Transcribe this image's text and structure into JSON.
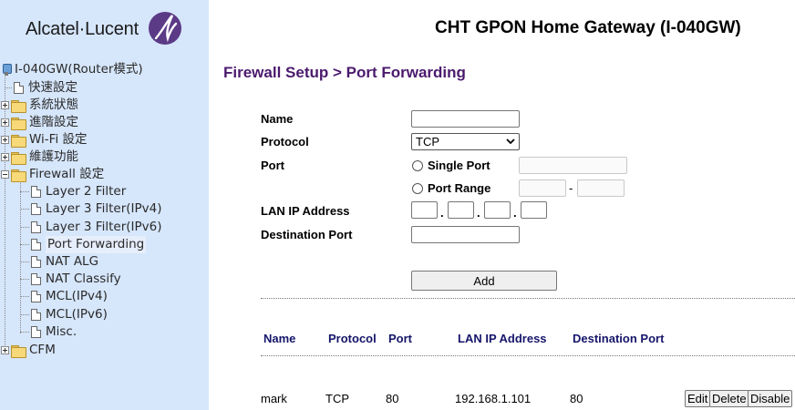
{
  "brand": {
    "logo_text": "Alcatel·Lucent"
  },
  "header": {
    "gateway_title": "CHT GPON Home Gateway (I-040GW)"
  },
  "sidebar": {
    "root_label": "I-040GW(Router模式)",
    "items": [
      {
        "label": "快速設定",
        "type": "page"
      },
      {
        "label": "系統狀態",
        "type": "folder"
      },
      {
        "label": "進階設定",
        "type": "folder"
      },
      {
        "label": "Wi-Fi 設定",
        "type": "folder"
      },
      {
        "label": "維護功能",
        "type": "folder"
      },
      {
        "label": "Firewall 設定",
        "type": "folder-open"
      },
      {
        "label": "Layer 2 Filter",
        "type": "sub"
      },
      {
        "label": "Layer 3 Filter(IPv4)",
        "type": "sub"
      },
      {
        "label": "Layer 3 Filter(IPv6)",
        "type": "sub"
      },
      {
        "label": "Port Forwarding",
        "type": "sub",
        "selected": true
      },
      {
        "label": "NAT ALG",
        "type": "sub"
      },
      {
        "label": "NAT Classify",
        "type": "sub"
      },
      {
        "label": "MCL(IPv4)",
        "type": "sub"
      },
      {
        "label": "MCL(IPv6)",
        "type": "sub"
      },
      {
        "label": "Misc.",
        "type": "sub"
      },
      {
        "label": "CFM",
        "type": "folder"
      }
    ]
  },
  "page": {
    "section_title": "Firewall Setup > Port Forwarding"
  },
  "form": {
    "name_label": "Name",
    "name_value": "",
    "protocol_label": "Protocol",
    "protocol_value": "TCP",
    "port_label": "Port",
    "single_port_label": "Single Port",
    "port_range_label": "Port Range",
    "range_separator": "-",
    "lan_ip_label": "LAN IP Address",
    "ip_dot": ".",
    "dest_port_label": "Destination Port",
    "add_label": "Add"
  },
  "table": {
    "headers": [
      "Name",
      "Protocol",
      "Port",
      "LAN IP Address",
      "Destination Port"
    ],
    "rows": [
      {
        "name": "mark",
        "protocol": "TCP",
        "port": "80",
        "lan_ip": "192.168.1.101",
        "dest_port": "80"
      }
    ],
    "actions": {
      "edit": "Edit",
      "delete": "Delete",
      "disable": "Disable"
    }
  },
  "colors": {
    "sidebar_bg": "#d6e6fb",
    "section_title": "#4b1a6e",
    "table_header": "#15156b"
  }
}
